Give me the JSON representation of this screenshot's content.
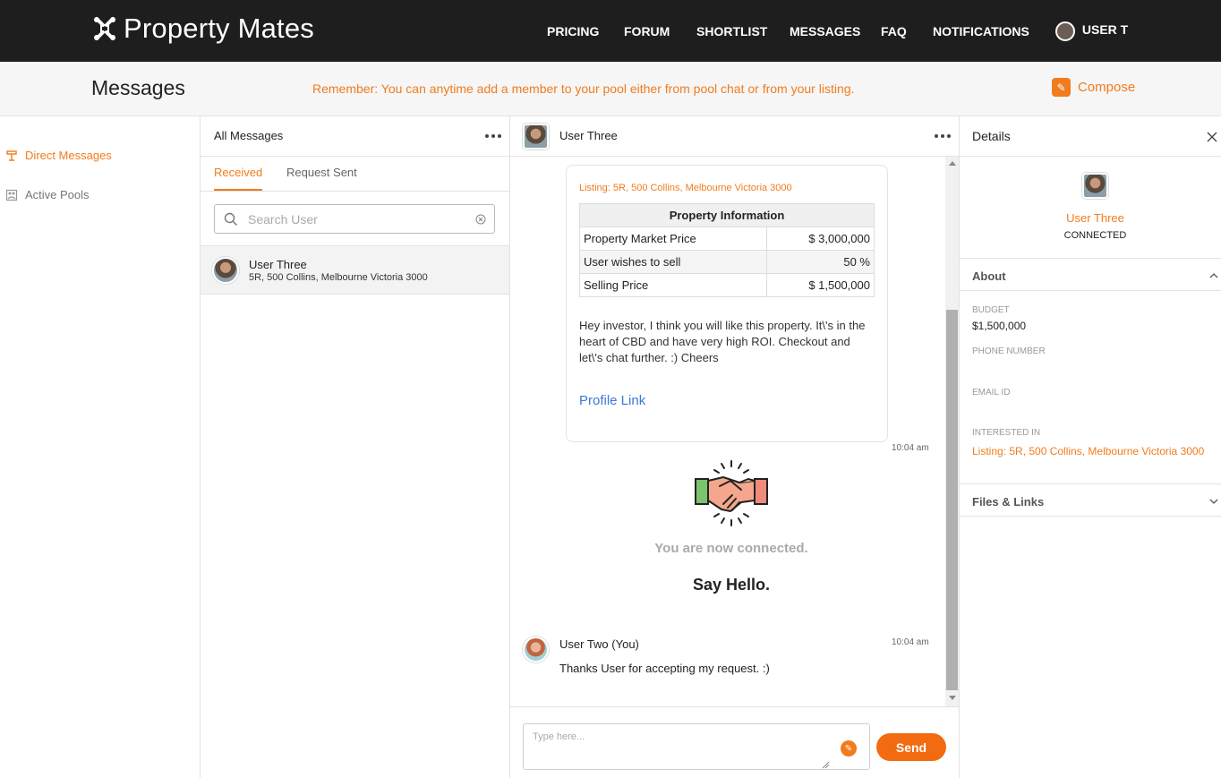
{
  "brand": {
    "name": "Property Mates"
  },
  "nav": {
    "pricing": "PRICING",
    "forum": "FORUM",
    "shortlist": "SHORTLIST",
    "messages": "MESSAGES",
    "faq": "FAQ",
    "notifications": "NOTIFICATIONS",
    "user": "USER T"
  },
  "subheader": {
    "title": "Messages",
    "reminder": "Remember: You can anytime add a member to your pool either from pool chat or from your listing.",
    "compose": "Compose"
  },
  "sidebar": {
    "items": [
      {
        "label": "Direct Messages",
        "icon": "direct-messages-icon",
        "active": true
      },
      {
        "label": "Active Pools",
        "icon": "pool-icon",
        "active": false
      }
    ]
  },
  "list_panel": {
    "title": "All Messages",
    "tabs": [
      {
        "label": "Received",
        "active": true
      },
      {
        "label": "Request Sent",
        "active": false
      }
    ],
    "search_placeholder": "Search User",
    "conversations": [
      {
        "name": "User Three",
        "subtitle": "5R, 500 Collins, Melbourne Victoria 3000"
      }
    ]
  },
  "chat": {
    "header_name": "User Three",
    "card": {
      "listing": "Listing: 5R, 500 Collins, Melbourne Victoria 3000",
      "table_header": "Property Information",
      "rows": [
        {
          "label": "Property Market Price",
          "value": "$ 3,000,000"
        },
        {
          "label": "User wishes to sell",
          "value": "50 %"
        },
        {
          "label": "Selling Price",
          "value": "$ 1,500,000"
        }
      ],
      "message": "Hey investor, I think you will like this property. It\\'s in the heart of CBD and have very high ROI. Checkout and let\\'s chat further. :) Cheers",
      "profile_link": "Profile Link",
      "time": "10:04 am"
    },
    "connected_text": "You are now connected.",
    "say_hello": "Say Hello.",
    "reply": {
      "sender": "User Two (You)",
      "time": "10:04 am",
      "text": "Thanks User for accepting my request. :)"
    },
    "composer_placeholder": "Type here...",
    "send_label": "Send"
  },
  "details": {
    "title": "Details",
    "name": "User Three",
    "status": "CONNECTED",
    "about_label": "About",
    "budget_label": "BUDGET",
    "budget_value": "$1,500,000",
    "phone_label": "PHONE NUMBER",
    "email_label": "EMAIL ID",
    "interested_label": "INTERESTED IN",
    "interested_value": "Listing: 5R, 500 Collins, Melbourne Victoria 3000",
    "files_label": "Files & Links"
  },
  "colors": {
    "accent": "#f07c1e",
    "topbar": "#1e1e1e",
    "link": "#3b78d8"
  }
}
